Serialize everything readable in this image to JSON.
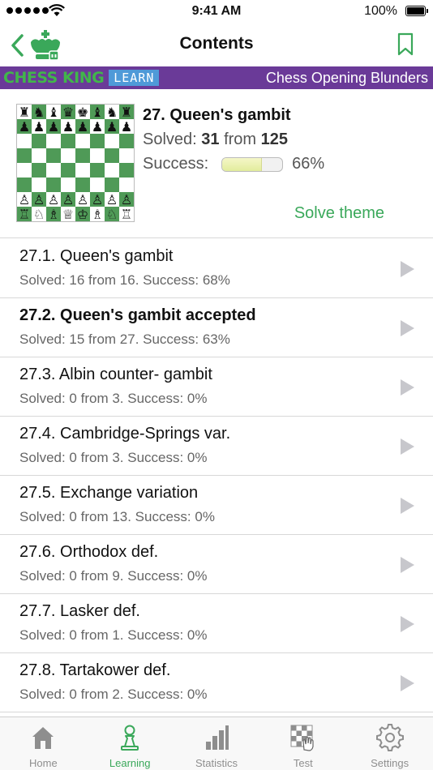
{
  "status_bar": {
    "time": "9:41 AM",
    "battery": "100%"
  },
  "nav": {
    "title": "Contents"
  },
  "banner": {
    "brand": "CHESS KING",
    "badge": "LEARN",
    "course_title": "Chess Opening Blunders"
  },
  "theme": {
    "title": "27. Queen's gambit",
    "solved_label": "Solved:",
    "solved_count": "31",
    "from_label": "from",
    "total": "125",
    "success_label": "Success:",
    "success_value": 0.66,
    "success_pct": "66%",
    "solve_button": "Solve theme"
  },
  "list": [
    {
      "title": "27.1. Queen's gambit",
      "subtitle": "Solved: 16 from 16. Success: 68%",
      "bold": false
    },
    {
      "title": "27.2. Queen's gambit accepted",
      "subtitle": "Solved: 15 from 27. Success: 63%",
      "bold": true
    },
    {
      "title": "27.3. Albin counter- gambit",
      "subtitle": "Solved: 0 from 3. Success: 0%",
      "bold": false
    },
    {
      "title": "27.4. Cambridge-Springs var.",
      "subtitle": "Solved: 0 from 3. Success: 0%",
      "bold": false
    },
    {
      "title": "27.5. Exchange variation",
      "subtitle": "Solved: 0 from 13. Success: 0%",
      "bold": false
    },
    {
      "title": "27.6. Orthodox def.",
      "subtitle": "Solved: 0 from 9. Success: 0%",
      "bold": false
    },
    {
      "title": "27.7. Lasker def.",
      "subtitle": "Solved: 0 from 1. Success: 0%",
      "bold": false
    },
    {
      "title": "27.8. Tartakower def.",
      "subtitle": "Solved: 0 from 2. Success: 0%",
      "bold": false
    }
  ],
  "tabs": [
    {
      "label": "Home",
      "icon": "home-icon"
    },
    {
      "label": "Learning",
      "icon": "pawn-icon",
      "active": true
    },
    {
      "label": "Statistics",
      "icon": "bar-chart-icon"
    },
    {
      "label": "Test",
      "icon": "chessboard-hand-icon"
    },
    {
      "label": "Settings",
      "icon": "gear-icon"
    }
  ],
  "colors": {
    "accent": "#3aa85a",
    "banner": "#6a3a98",
    "badge": "#4f9ad8",
    "board_dark": "#4f9a57",
    "board_light": "#ffffff"
  },
  "board": {
    "ranks": [
      "rnbqkbnr",
      "pppppppp",
      "........",
      "........",
      "........",
      "........",
      "PPPPPPPP",
      "RNBQKBNR"
    ]
  }
}
